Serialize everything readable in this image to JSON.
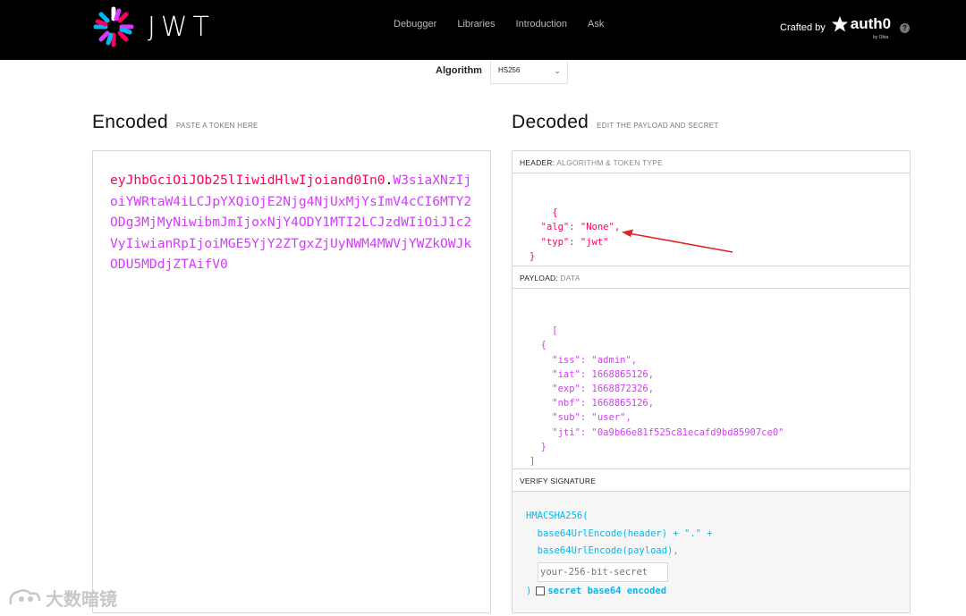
{
  "brand": {
    "logo_text": "JWT"
  },
  "nav": {
    "items": [
      "Debugger",
      "Libraries",
      "Introduction",
      "Ask"
    ]
  },
  "crafted": {
    "label": "Crafted by",
    "brand": "auth0",
    "byline": "by Okta",
    "help": "?"
  },
  "algorithm": {
    "label": "Algorithm",
    "value": "HS256"
  },
  "encoded": {
    "title": "Encoded",
    "subtitle": "PASTE A TOKEN HERE",
    "token_header": "eyJhbGciOiJOb25lIiwidHlwIjoiand0In0",
    "token_dot": ".",
    "token_payload": "W3siaXNzIjoiYWRtaW4iLCJpYXQiOjE2Njg4NjUxMjYsImV4cCI6MTY2ODg3MjMyNiwibmJmIjoxNjY4ODY1MTI2LCJzdWIiOiJ1c2VyIiwianRpIjoiMGE5YjY2ZTgxZjUyNWM4MWVjYWZkOWJkODU5MDdjZTAifV0"
  },
  "decoded": {
    "title": "Decoded",
    "subtitle": "EDIT THE PAYLOAD AND SECRET",
    "header_section": {
      "label": "HEADER:",
      "sublabel": "ALGORITHM & TOKEN TYPE"
    },
    "header_json": "{\n  \"alg\": \"None\",\n  \"typ\": \"jwt\"\n}",
    "payload_section": {
      "label": "PAYLOAD:",
      "sublabel": "DATA"
    },
    "payload_json": "[\n  {\n    \"iss\": \"admin\",\n    \"iat\": 1668865126,\n    \"exp\": 1668872326,\n    \"nbf\": 1668865126,\n    \"sub\": \"user\",\n    \"jti\": \"0a9b66e81f525c81ecafd9bd85907ce0\"\n  }\n]",
    "signature_section": {
      "label": "VERIFY SIGNATURE"
    },
    "signature": {
      "fn": "HMACSHA256(",
      "line1": "  base64UrlEncode(header) + \".\" +",
      "line2": "  base64UrlEncode(payload),",
      "secret_placeholder": "your-256-bit-secret",
      "close": ")",
      "checkbox_label": "secret base64 encoded"
    }
  },
  "watermark": {
    "text": "大数暗镜"
  },
  "colors": {
    "header_red": "#fb015b",
    "payload_purple": "#d63aff",
    "signature_blue": "#00b9f1",
    "annotation_red": "#e32222"
  }
}
